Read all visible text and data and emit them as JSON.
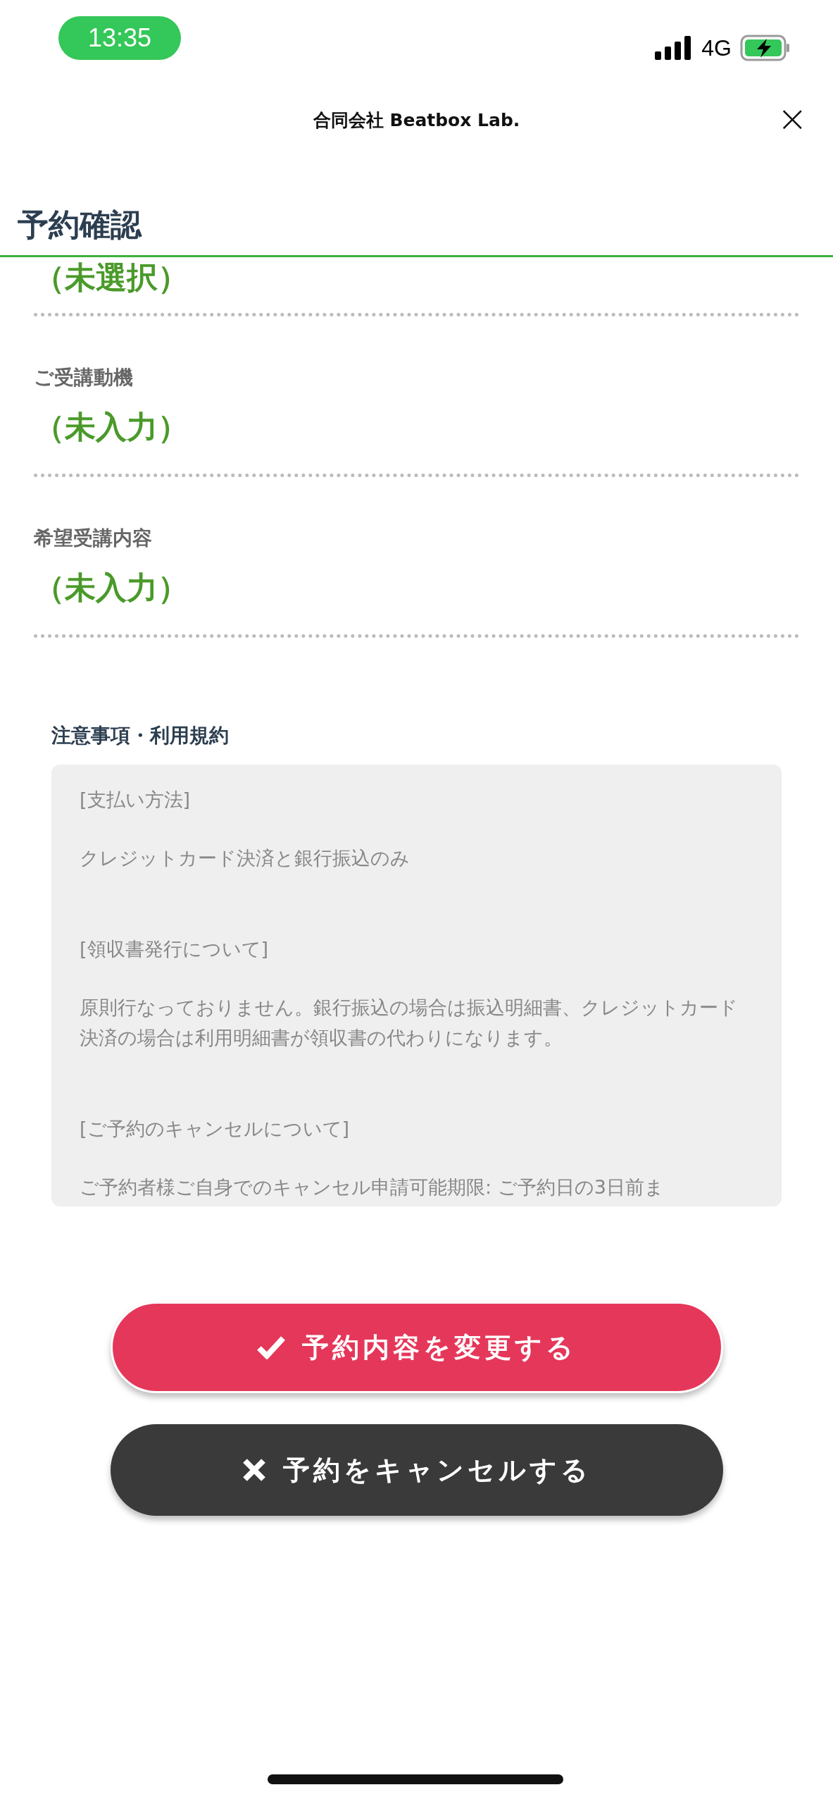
{
  "status_bar": {
    "time": "13:35",
    "network": "4G"
  },
  "header": {
    "title": "合同会社 Beatbox Lab.",
    "close": "×"
  },
  "page_title": "予約確認",
  "fields": [
    {
      "value": "（未選択）"
    },
    {
      "label": "ご受講動機",
      "value": "（未入力）"
    },
    {
      "label": "希望受講内容",
      "value": "（未入力）"
    }
  ],
  "notes": {
    "title": "注意事項・利用規約",
    "paragraphs": [
      {
        "kind": "heading",
        "text": "[支払い方法]"
      },
      {
        "kind": "text",
        "text": "クレジットカード決済と銀行振込のみ"
      },
      {
        "kind": "heading",
        "text": "[領収書発行について]"
      },
      {
        "kind": "text",
        "text": "原則行なっておりません。銀行振込の場合は振込明細書、クレジットカード決済の場合は利用明細書が領収書の代わりになります。"
      },
      {
        "kind": "heading",
        "text": "[ご予約のキャンセルについて]"
      },
      {
        "kind": "text",
        "text": "ご予約者様ご自身でのキャンセル申請可能期限: ご予約日の3日前ま"
      }
    ]
  },
  "buttons": [
    {
      "kind": "change",
      "label": "予約内容を変更する"
    },
    {
      "kind": "cancel",
      "label": "予約をキャンセルする"
    }
  ]
}
